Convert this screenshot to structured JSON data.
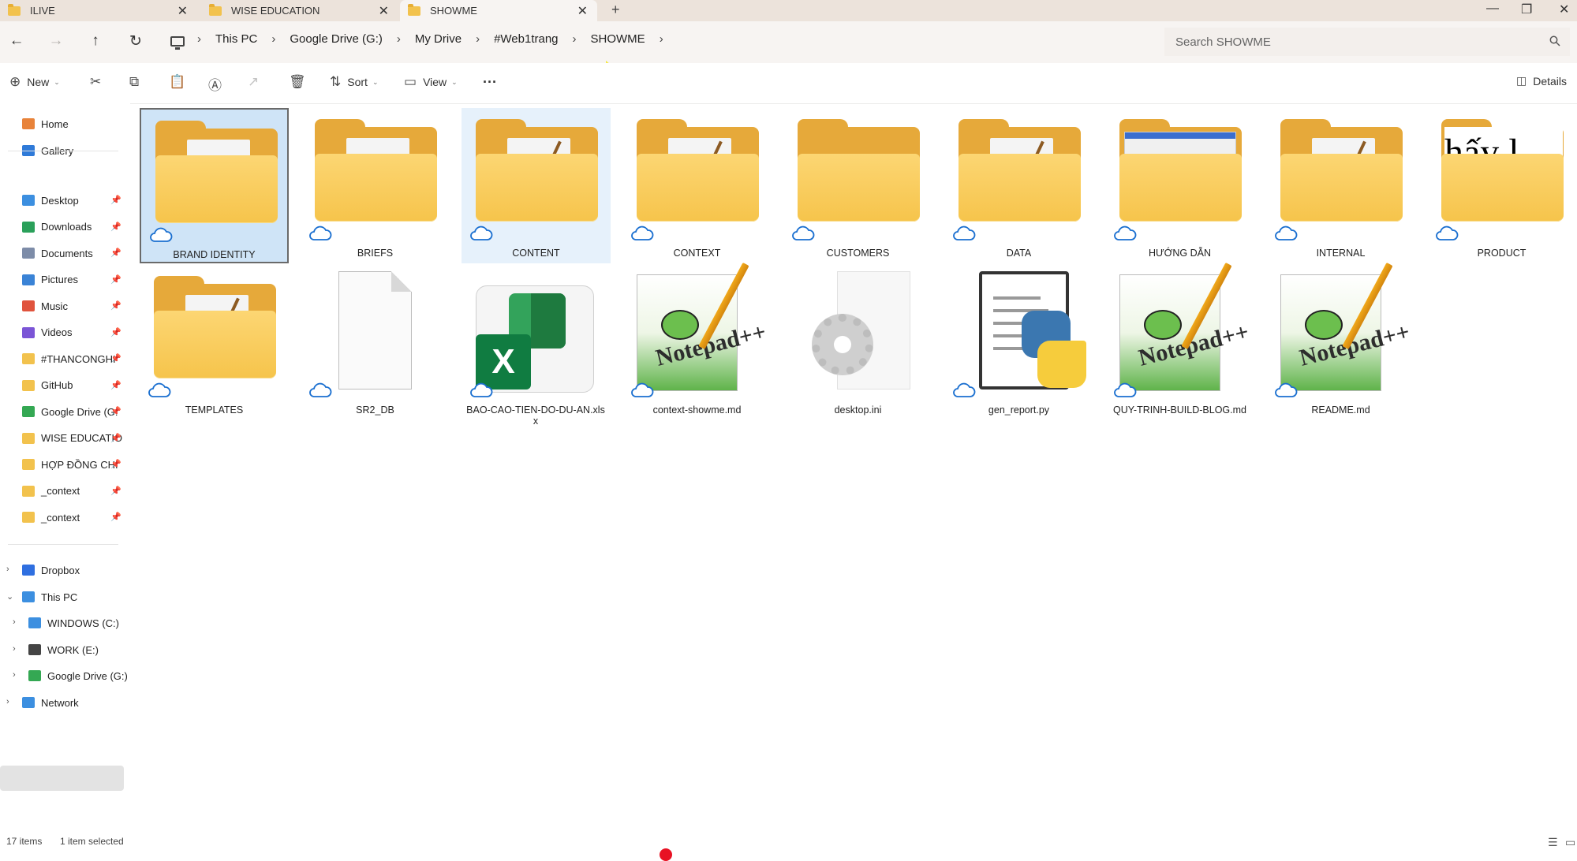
{
  "tabs": [
    {
      "label": "ILIVE",
      "close": "✕"
    },
    {
      "label": "WISE EDUCATION",
      "close": "✕"
    },
    {
      "label": "SHOWME",
      "close": "✕"
    }
  ],
  "new_tab": "+",
  "window": {
    "minimize": "—",
    "restore": "❐",
    "close": "✕"
  },
  "nav": {
    "back": "←",
    "forward": "→",
    "up": "↑",
    "refresh": "↻"
  },
  "breadcrumb": [
    "This PC",
    "Google Drive (G:)",
    "My Drive",
    "#Web1trang",
    "SHOWME"
  ],
  "breadcrumb_sep": "›",
  "search": {
    "placeholder": "Search SHOWME",
    "icon": "search-icon"
  },
  "commands": {
    "new": "New",
    "sort": "Sort",
    "view": "View",
    "more": "···",
    "details": "Details"
  },
  "sidebar": {
    "top": [
      {
        "label": "Home",
        "icon": "home-icon",
        "color": "#e8833a"
      },
      {
        "label": "Gallery",
        "icon": "gallery-icon",
        "color": "#2f7ad8"
      }
    ],
    "pinned": [
      {
        "label": "Desktop",
        "icon": "desktop-icon",
        "color": "#3c8fe0"
      },
      {
        "label": "Downloads",
        "icon": "downloads-icon",
        "color": "#2aa05a"
      },
      {
        "label": "Documents",
        "icon": "documents-icon",
        "color": "#7d8ca8"
      },
      {
        "label": "Pictures",
        "icon": "pictures-icon",
        "color": "#3a83d6"
      },
      {
        "label": "Music",
        "icon": "music-icon",
        "color": "#e0533d"
      },
      {
        "label": "Videos",
        "icon": "videos-icon",
        "color": "#7b55d6"
      },
      {
        "label": "#THANCONGHI",
        "icon": "folder-icon",
        "color": "#f2c24d"
      },
      {
        "label": "GitHub",
        "icon": "folder-icon",
        "color": "#f2c24d"
      },
      {
        "label": "Google Drive (G:",
        "icon": "google-drive-icon",
        "color": "#34a853"
      },
      {
        "label": "WISE EDUCATIO",
        "icon": "folder-icon",
        "color": "#f2c24d"
      },
      {
        "label": "HỢP ĐỒNG CHI",
        "icon": "folder-icon",
        "color": "#f2c24d"
      },
      {
        "label": "_context",
        "icon": "folder-icon",
        "color": "#f2c24d"
      },
      {
        "label": "_context",
        "icon": "folder-icon",
        "color": "#f2c24d"
      }
    ],
    "pin_glyph": "📌",
    "tree": [
      {
        "label": "Dropbox",
        "icon": "dropbox-icon",
        "color": "#2f6fe0",
        "chevron": "›"
      },
      {
        "label": "This PC",
        "icon": "pc-icon",
        "color": "#3c8fe0",
        "chevron": "⌄"
      },
      {
        "label": "WINDOWS (C:)",
        "icon": "drive-icon",
        "color": "#3c8fe0",
        "chevron": "›"
      },
      {
        "label": "WORK (E:)",
        "icon": "drive-icon",
        "color": "#444444",
        "chevron": "›"
      },
      {
        "label": "Google Drive (G:)",
        "icon": "google-drive-icon",
        "color": "#34a853",
        "chevron": "›"
      },
      {
        "label": "Network",
        "icon": "network-icon",
        "color": "#3c8fe0",
        "chevron": "›"
      }
    ]
  },
  "items": {
    "folders": [
      "BRAND IDENTITY",
      "BRIEFS",
      "CONTENT",
      "CONTEXT",
      "CUSTOMERS",
      "DATA",
      "HƯỚNG DẪN",
      "INTERNAL",
      "PRODUCT"
    ],
    "row2": [
      "TEMPLATES",
      "SR2_DB",
      "BAO-CAO-TIEN-DO-DU-AN.xlsx",
      "context-showme.md",
      "desktop.ini",
      "gen_report.py",
      "QUY-TRINH-BUILD-BLOG.md",
      "README.md"
    ]
  },
  "thumb_text": {
    "product": "hấy l",
    "excel": "X",
    "notepad": "Notepad++"
  },
  "status": {
    "count": "17 items",
    "selection": "1 item selected"
  },
  "colors": {
    "accent": "#0067c0",
    "folder": "#f6c44b",
    "selected_bg": "#cfe4f7"
  }
}
